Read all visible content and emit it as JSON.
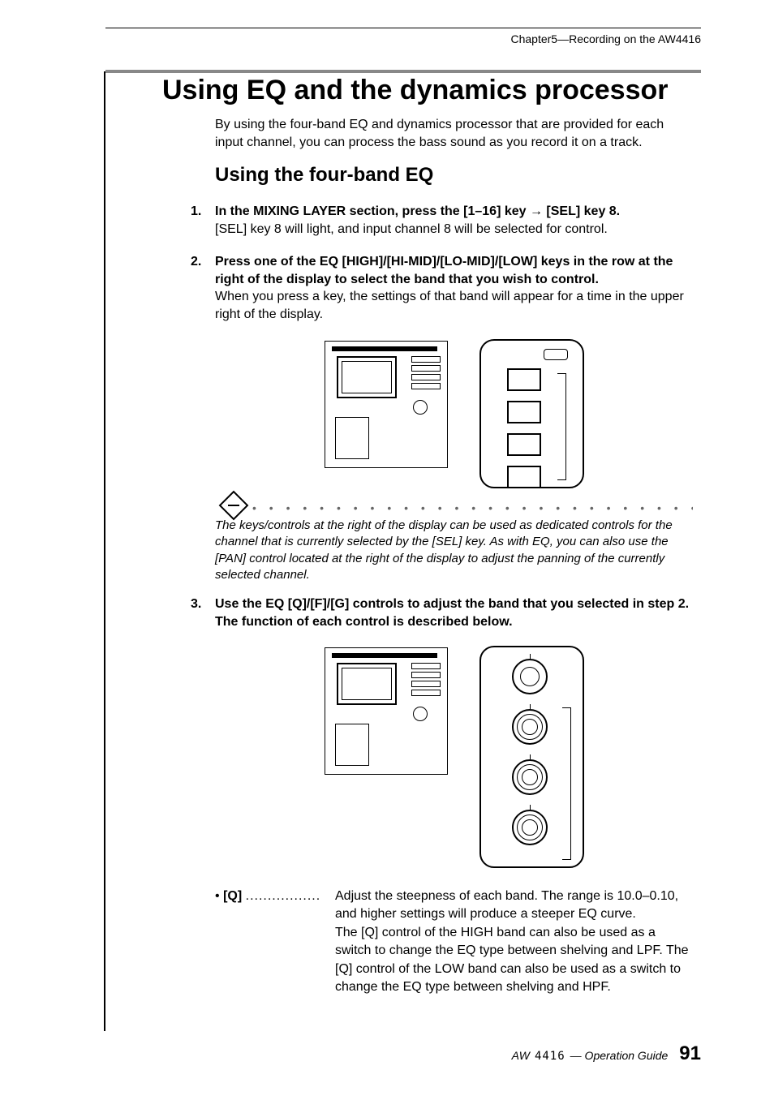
{
  "header": {
    "chapter": "Chapter5—Recording on the AW4416"
  },
  "title": "Using EQ and the dynamics processor",
  "intro": "By using the four-band EQ and dynamics processor that are provided for each input channel, you can process the bass sound as you record it on a track.",
  "subtitle": "Using the four-band EQ",
  "steps": {
    "s1": {
      "num": "1.",
      "bold": "In the MIXING LAYER section, press the [1–16] key → [SEL] key 8.",
      "plain": "[SEL] key 8 will light, and input channel 8 will be selected for control."
    },
    "s2": {
      "num": "2.",
      "bold": "Press one of the EQ [HIGH]/[HI-MID]/[LO-MID]/[LOW] keys in the row at the right of the display to select the band that you wish to control.",
      "plain": "When you press a key, the settings of that band will appear for a time in the upper right of the display."
    },
    "s3": {
      "num": "3.",
      "bold": "Use the EQ [Q]/[F]/[G] controls to adjust the band that you selected in step 2. The function of each control is described below."
    }
  },
  "tip": {
    "dots": "• • • • • • • • • • • • • • • • • • • • • • • • • • • • • • • • • • • • • • • • • • • • • •",
    "text": "The keys/controls at the right of the display can be used as dedicated controls for the channel that is currently selected by the [SEL] key. As with EQ, you can also use the [PAN] control located at the right of the display to adjust the panning of the currently selected channel."
  },
  "bullet": {
    "label_bullet": "•",
    "label_q": "[Q]",
    "label_dots": ".................",
    "text": "Adjust the steepness of each band. The range is 10.0–0.10, and higher settings will produce a steeper EQ curve.\nThe [Q] control of the HIGH band can also be used as a switch to change the EQ type between shelving and LPF. The [Q] control of the LOW band can also be used as a switch to change the EQ type between shelving and HPF."
  },
  "footer": {
    "model_prefix": "AW",
    "model": "4416",
    "guide": "— Operation Guide",
    "page": "91"
  }
}
